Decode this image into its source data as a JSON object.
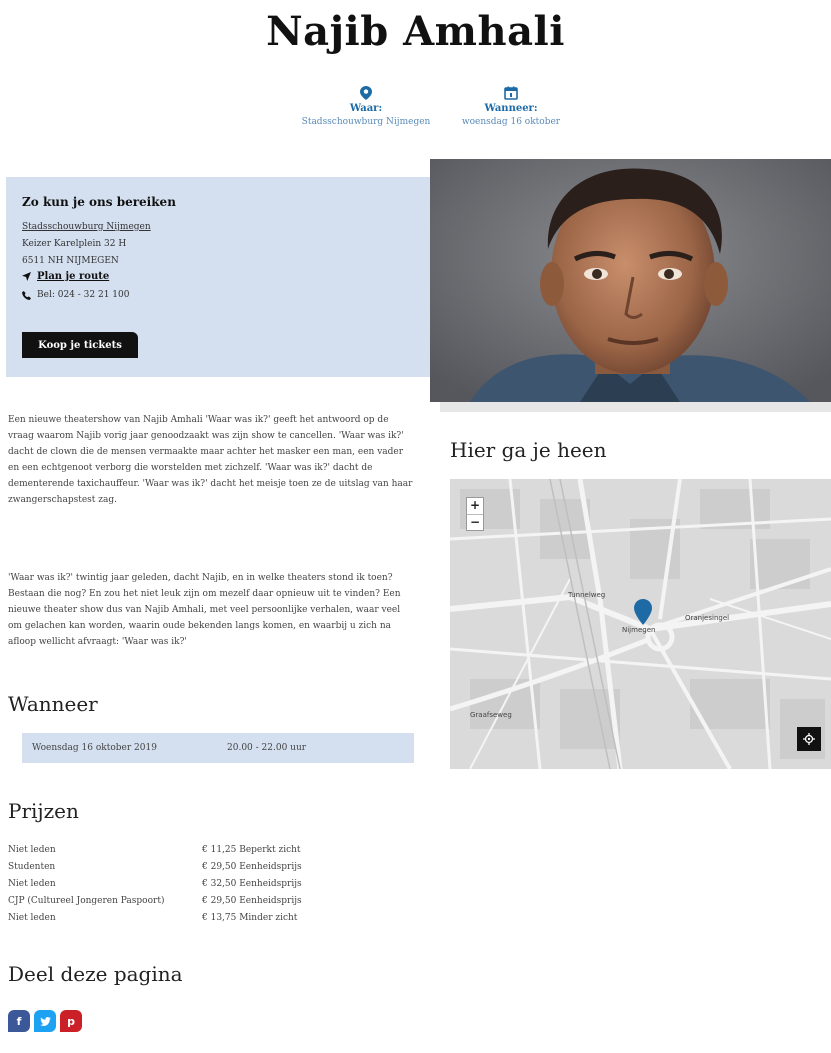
{
  "title": "Najib Amhali",
  "meta": {
    "where_label": "Waar:",
    "where_value": "Stadsschouwburg Nijmegen",
    "when_label": "Wanneer:",
    "when_value": "woensdag 16 oktober"
  },
  "contact": {
    "heading": "Zo kun je ons bereiken",
    "venue": "Stadsschouwburg Nijmegen",
    "street": "Keizer Karelplein 32 H",
    "city": "6511 NH NIJMEGEN",
    "route_label": "Plan je route",
    "phone": "Bel: 024 - 32 21 100",
    "ticket_button": "Koop je tickets"
  },
  "description": {
    "p1": "Een nieuwe theatershow van Najib Amhali 'Waar was ik?' geeft het antwoord op de vraag waarom Najib vorig jaar genoodzaakt was zijn show te cancellen. 'Waar was ik?' dacht de clown die de mensen vermaakte maar achter het masker een man, een vader en een echtgenoot verborg die worstelden met zichzelf. 'Waar was ik?' dacht de dementerende taxichauffeur. 'Waar was ik?' dacht het meisje toen ze de uitslag van haar zwangerschapstest zag.",
    "p2": "'Waar was ik?' twintig jaar geleden, dacht Najib, en in welke theaters stond ik toen? Bestaan die nog? En zou het niet leuk zijn om mezelf daar opnieuw uit te vinden? Een nieuwe theater show dus van Najib Amhali, met veel persoonlijke verhalen, waar veel om gelachen kan worden, waarin oude bekenden langs komen, en waarbij u zich na afloop wellicht afvraagt: 'Waar was ik?'"
  },
  "when": {
    "heading": "Wanneer",
    "date": "Woensdag 16 oktober 2019",
    "time": "20.00 - 22.00 uur"
  },
  "prices": {
    "heading": "Prijzen",
    "rows": [
      {
        "category": "Niet leden",
        "amount": "€ 11,25 Beperkt zicht"
      },
      {
        "category": "Studenten",
        "amount": "€ 29,50 Eenheidsprijs"
      },
      {
        "category": "Niet leden",
        "amount": "€ 32,50 Eenheidsprijs"
      },
      {
        "category": "CJP (Cultureel Jongeren Paspoort)",
        "amount": "€ 29,50 Eenheidsprijs"
      },
      {
        "category": "Niet leden",
        "amount": "€ 13,75 Minder zicht"
      }
    ]
  },
  "share": {
    "heading": "Deel deze pagina",
    "facebook_glyph": "f",
    "pinterest_glyph": "p"
  },
  "map": {
    "heading": "Hier ga je heen",
    "zoom_in": "+",
    "zoom_out": "−",
    "city_label": "Nijmegen",
    "street_1": "Tunnelweg",
    "street_2": "Oranjesingel",
    "street_3": "Graafseweg",
    "marker_color": "#1d6aa5"
  },
  "colors": {
    "accent": "#1d6aa5",
    "panel": "#d4e0f0"
  }
}
